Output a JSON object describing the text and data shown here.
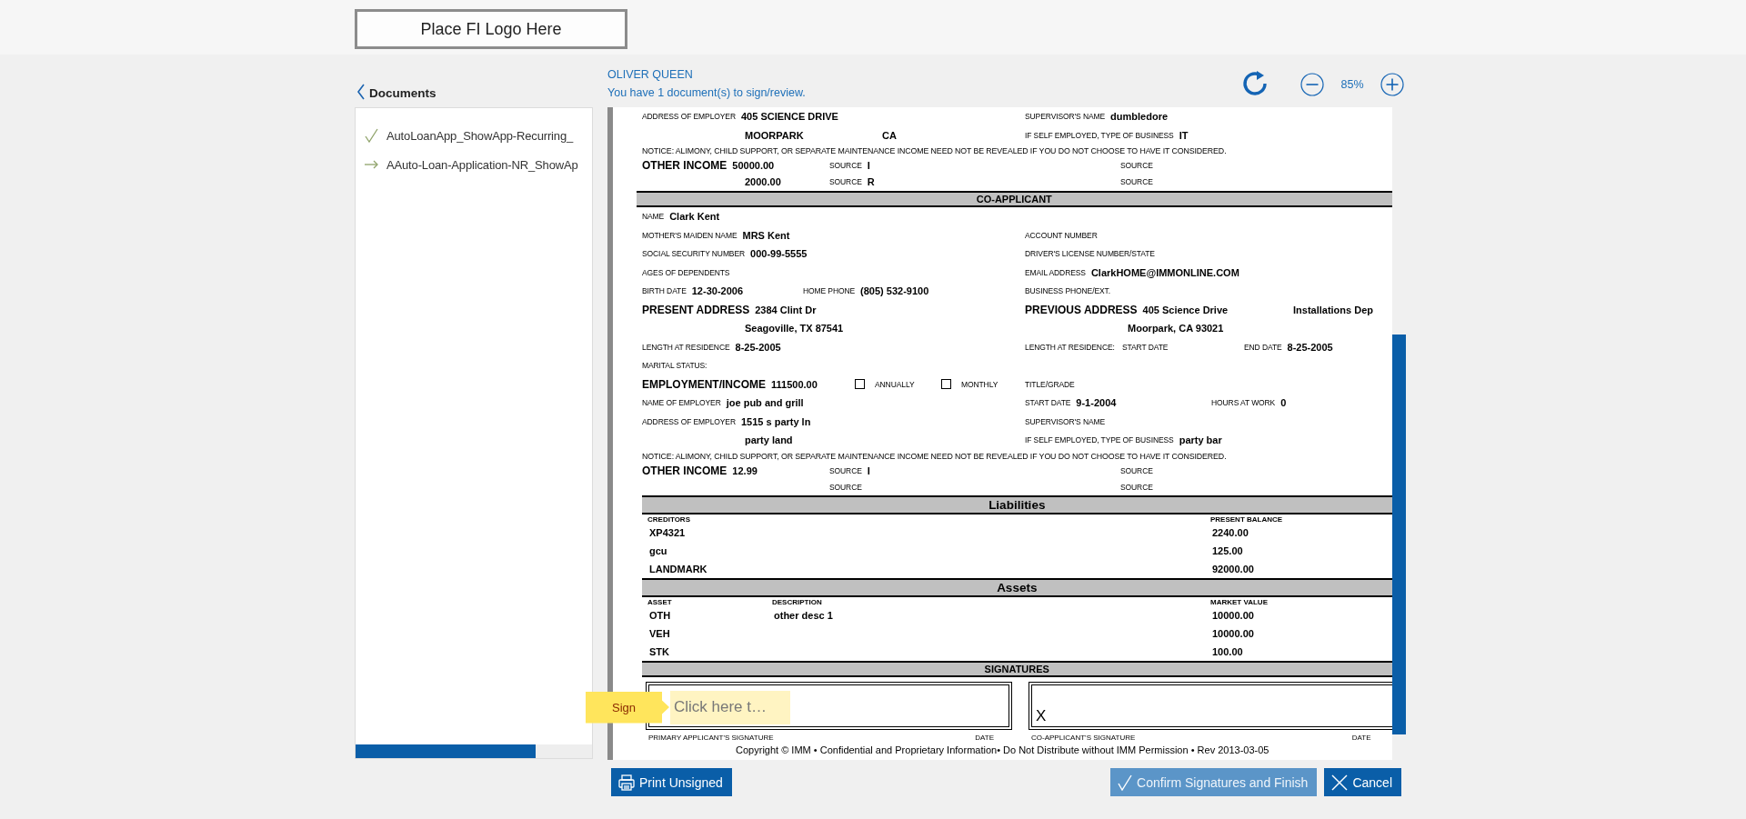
{
  "logo": {
    "text": "Place FI Logo Here"
  },
  "sidebar": {
    "title": "Documents",
    "items": [
      {
        "name": "AutoLoanApp_ShowApp-Recurring_",
        "kind": "signed"
      },
      {
        "name": "AAuto-Loan-Application-NR_ShowAp",
        "kind": "current"
      }
    ],
    "progress": {
      "level": 0.76
    }
  },
  "viewer": {
    "signer": "OLIVER QUEEN",
    "message": "You have 1 document(s) to sign/review.",
    "zoom": "85%"
  },
  "document": {
    "rows": [
      {
        "kind": "pair",
        "cells": [
          {
            "kind": "field",
            "label": "ADDRESS OF EMPLOYER",
            "value": "405 SCIENCE DRIVE"
          },
          {
            "kind": "field",
            "label": "SUPERVISOR'S NAME",
            "value": "dumbledore"
          }
        ]
      },
      {
        "kind": "addr2",
        "cells": [
          {
            "kind": "indent",
            "value": "MOORPARK"
          },
          {
            "kind": "field",
            "value": "CA"
          },
          {
            "kind": "field",
            "label": "IF SELF EMPLOYED, TYPE OF BUSINESS",
            "value": "IT"
          }
        ]
      },
      {
        "kind": "notice",
        "text": "NOTICE: ALIMONY, CHILD SUPPORT, OR SEPARATE MAINTENANCE INCOME NEED NOT BE REVEALED IF YOU DO NOT CHOOSE TO HAVE IT CONSIDERED."
      },
      {
        "kind": "income",
        "cells": [
          {
            "kind": "major",
            "label": "OTHER INCOME",
            "value": "50000.00"
          },
          {
            "kind": "field",
            "label": "SOURCE",
            "value": "I"
          },
          {
            "kind": "field",
            "label": "SOURCE"
          }
        ]
      },
      {
        "kind": "income",
        "cells": [
          {
            "kind": "indent",
            "value": "2000.00"
          },
          {
            "kind": "field",
            "label": "SOURCE",
            "value": "R"
          },
          {
            "kind": "field",
            "label": "SOURCE"
          }
        ]
      },
      {
        "kind": "section",
        "title": "CO-APPLICANT"
      },
      {
        "kind": "single",
        "cells": [
          {
            "kind": "field",
            "label": "NAME",
            "value": "Clark Kent"
          }
        ]
      },
      {
        "kind": "pair",
        "cells": [
          {
            "kind": "field",
            "label": "MOTHER'S MAIDEN NAME",
            "value": "MRS Kent"
          },
          {
            "kind": "field",
            "label": "ACCOUNT NUMBER"
          }
        ]
      },
      {
        "kind": "pair",
        "cells": [
          {
            "kind": "field",
            "label": "SOCIAL SECURITY NUMBER",
            "value": "000-99-5555"
          },
          {
            "kind": "field",
            "label": "DRIVER'S LICENSE NUMBER/STATE"
          }
        ]
      },
      {
        "kind": "pair",
        "cells": [
          {
            "kind": "field",
            "label": "AGES OF DEPENDENTS"
          },
          {
            "kind": "field",
            "label": "EMAIL ADDRESS",
            "value": "ClarkHOME@IMMONLINE.COM"
          }
        ]
      },
      {
        "kind": "birth",
        "cells": [
          {
            "kind": "field",
            "label": "BIRTH DATE",
            "value": "12-30-2006"
          },
          {
            "kind": "field",
            "label": "HOME PHONE",
            "value": "(805) 532-9100"
          },
          {
            "kind": "field",
            "label": "BUSINESS PHONE/EXT."
          }
        ]
      },
      {
        "kind": "prev_address",
        "cells": [
          {
            "kind": "major",
            "label": "PRESENT ADDRESS",
            "value": "2384 Clint Dr"
          },
          {
            "kind": "major",
            "label": "PREVIOUS ADDRESS",
            "value": "405 Science Drive"
          },
          {
            "kind": "field",
            "value": "Installations Dep"
          }
        ]
      },
      {
        "kind": "pair",
        "cells": [
          {
            "kind": "indent",
            "value": "Seagoville, TX 87541"
          },
          {
            "kind": "indent",
            "value": "Moorpark, CA 93021"
          }
        ]
      },
      {
        "kind": "residence",
        "cells": [
          {
            "kind": "field",
            "label": "LENGTH AT RESIDENCE",
            "value": "8-25-2005"
          },
          {
            "kind": "field",
            "label": "LENGTH AT RESIDENCE:"
          },
          {
            "kind": "field",
            "label": "START DATE"
          },
          {
            "kind": "field",
            "label": "END DATE",
            "value": "8-25-2005"
          }
        ]
      },
      {
        "kind": "single",
        "cells": [
          {
            "kind": "field",
            "label": "MARITAL STATUS:"
          }
        ]
      },
      {
        "kind": "employment",
        "cells": [
          {
            "kind": "major",
            "label": "EMPLOYMENT/INCOME",
            "value": "111500.00"
          },
          {
            "kind": "checkbox",
            "label": "ANNUALLY",
            "checked": false
          },
          {
            "kind": "checkbox",
            "label": "MONTHLY",
            "checked": false
          },
          {
            "kind": "field",
            "label": "TITLE/GRADE"
          }
        ]
      },
      {
        "kind": "employer",
        "cells": [
          {
            "kind": "field",
            "label": "NAME OF EMPLOYER",
            "value": "joe pub and grill"
          },
          {
            "kind": "field",
            "label": "START DATE",
            "value": "9-1-2004"
          },
          {
            "kind": "field",
            "label": "HOURS AT WORK",
            "value": "0"
          }
        ]
      },
      {
        "kind": "pair",
        "cells": [
          {
            "kind": "field",
            "label": "ADDRESS OF EMPLOYER",
            "value": "1515 s party ln"
          },
          {
            "kind": "field",
            "label": "SUPERVISOR'S NAME"
          }
        ]
      },
      {
        "kind": "pair",
        "cells": [
          {
            "kind": "indent",
            "value": "party land"
          },
          {
            "kind": "field",
            "label": "IF SELF EMPLOYED, TYPE OF BUSINESS",
            "value": "party bar"
          }
        ]
      },
      {
        "kind": "notice",
        "text": "NOTICE: ALIMONY, CHILD SUPPORT, OR SEPARATE MAINTENANCE INCOME NEED NOT BE REVEALED IF YOU DO NOT CHOOSE TO HAVE IT CONSIDERED."
      },
      {
        "kind": "income",
        "cells": [
          {
            "kind": "major",
            "label": "OTHER INCOME",
            "value": "12.99"
          },
          {
            "kind": "field",
            "label": "SOURCE",
            "value": "I"
          },
          {
            "kind": "field",
            "label": "SOURCE"
          }
        ]
      },
      {
        "kind": "income_cont",
        "cells": [
          {
            "kind": "field",
            "label": "SOURCE"
          },
          {
            "kind": "field",
            "label": "SOURCE"
          }
        ]
      },
      {
        "kind": "table",
        "title": "Liabilities",
        "columns": [
          "CREDITORS",
          "PRESENT BALANCE"
        ],
        "rows": [
          [
            "XP4321",
            "2240.00"
          ],
          [
            "gcu",
            "125.00"
          ],
          [
            "LANDMARK",
            "92000.00"
          ]
        ]
      },
      {
        "kind": "table",
        "title": "Assets",
        "columns": [
          "ASSET",
          "DESCRIPTION",
          "MARKET VALUE"
        ],
        "rows": [
          [
            "OTH",
            "other desc 1",
            "10000.00"
          ],
          [
            "VEH",
            null,
            "10000.00"
          ],
          [
            "STK",
            null,
            "100.00"
          ]
        ]
      },
      {
        "kind": "signatures",
        "title": "SIGNATURES",
        "boxes": [
          {
            "caption": "PRIMARY APPLICANT'S SIGNATURE",
            "date_label": "DATE"
          },
          {
            "mark": "X",
            "caption": "CO-APPLICANT'S SIGNATURE",
            "date_label": "DATE"
          }
        ]
      }
    ],
    "footer": "Copyright © IMM • Confidential and Proprietary Information• Do Not Distribute without IMM Permission • Rev 2013-03-05"
  },
  "sign_tag": {
    "label": "Sign",
    "placeholder": "Click here t…"
  },
  "buttons": [
    {
      "label": "Print Unsigned",
      "kind": "print",
      "disabled": false
    },
    {
      "label": "Confirm Signatures and Finish",
      "kind": "confirm",
      "disabled": true
    },
    {
      "label": "Cancel",
      "kind": "cancel",
      "disabled": false
    }
  ]
}
